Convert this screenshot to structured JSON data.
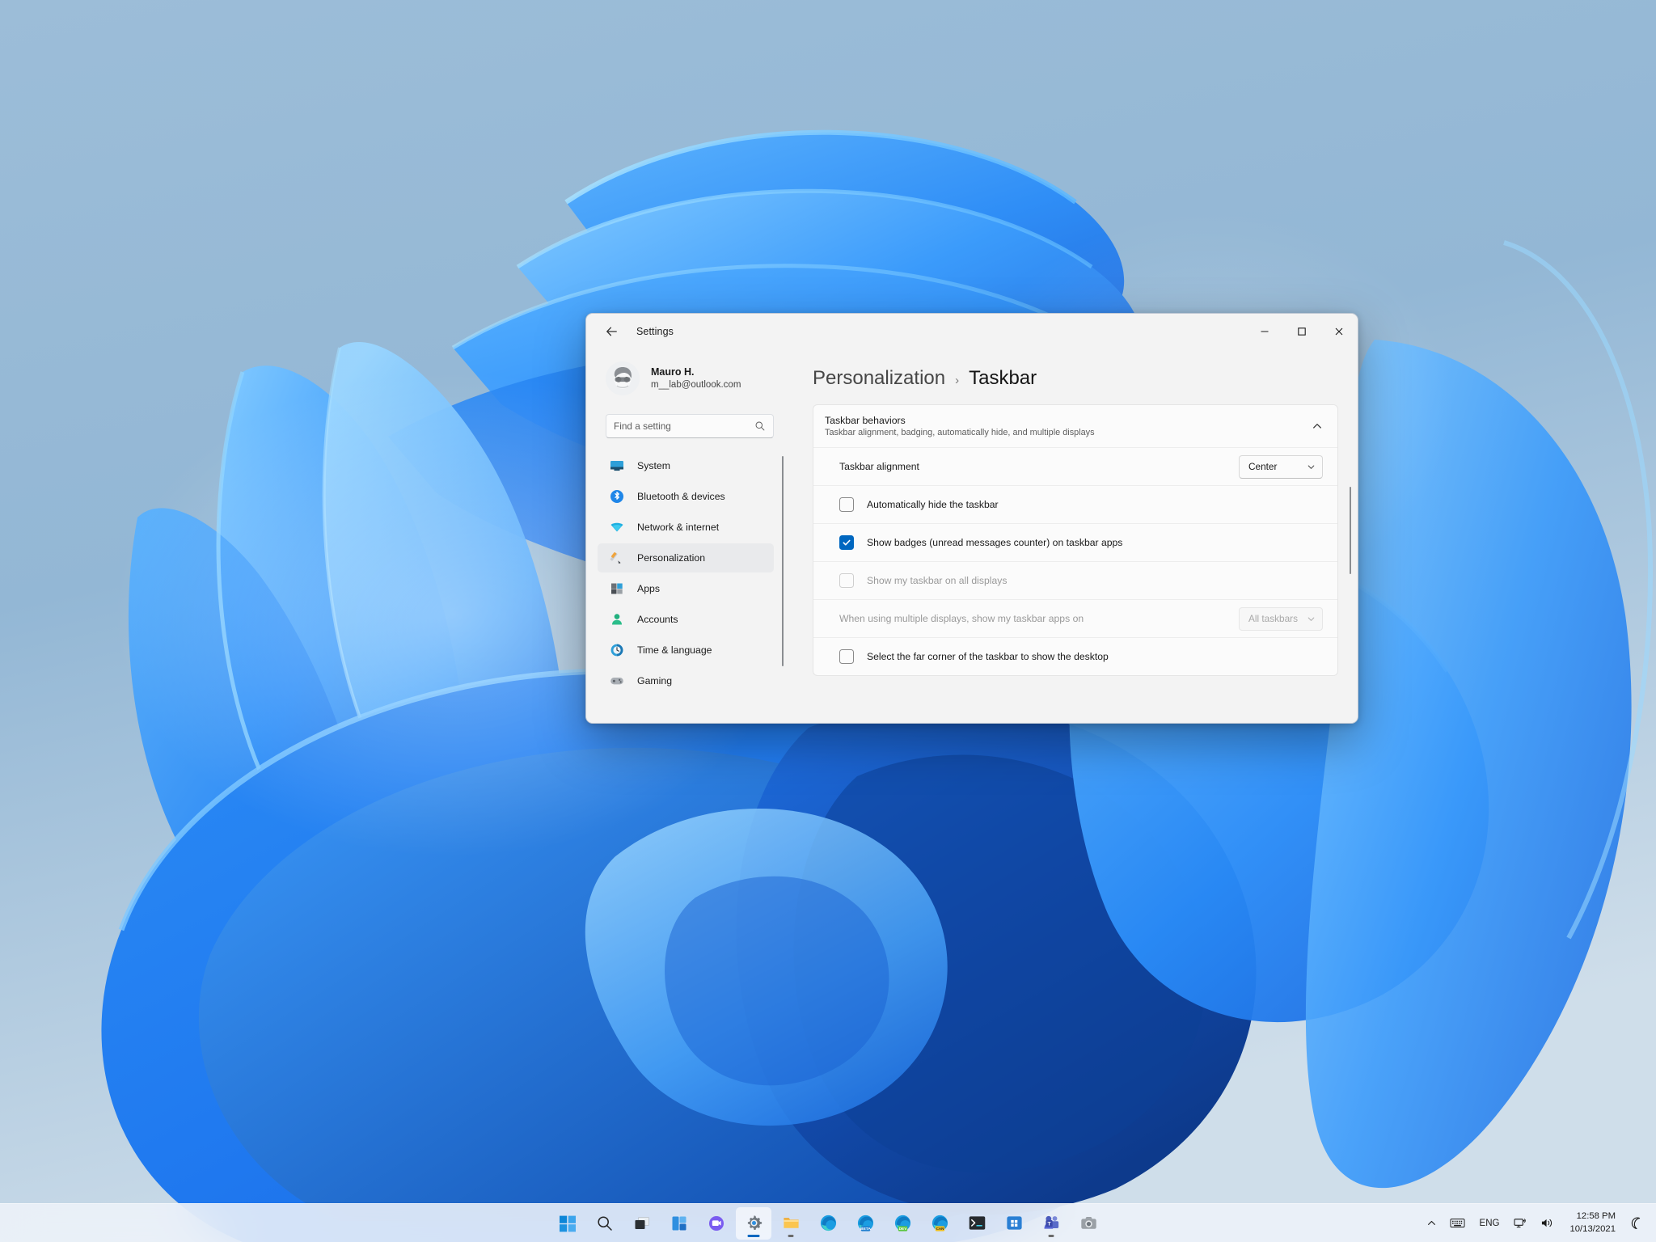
{
  "window": {
    "title": "Settings",
    "back_label": "Back",
    "minimize_label": "Minimize",
    "maximize_label": "Maximize",
    "close_label": "Close"
  },
  "account": {
    "name": "Mauro H.",
    "email": "m__lab@outlook.com"
  },
  "search": {
    "placeholder": "Find a setting"
  },
  "sidebar": {
    "items": [
      {
        "label": "System",
        "icon": "system-icon",
        "active": false
      },
      {
        "label": "Bluetooth & devices",
        "icon": "bluetooth-icon",
        "active": false
      },
      {
        "label": "Network & internet",
        "icon": "network-icon",
        "active": false
      },
      {
        "label": "Personalization",
        "icon": "personalization-icon",
        "active": true
      },
      {
        "label": "Apps",
        "icon": "apps-icon",
        "active": false
      },
      {
        "label": "Accounts",
        "icon": "accounts-icon",
        "active": false
      },
      {
        "label": "Time & language",
        "icon": "time-language-icon",
        "active": false
      },
      {
        "label": "Gaming",
        "icon": "gaming-icon",
        "active": false
      }
    ]
  },
  "breadcrumb": {
    "parent": "Personalization",
    "separator": "›",
    "current": "Taskbar"
  },
  "card": {
    "title": "Taskbar behaviors",
    "subtitle": "Taskbar alignment, badging, automatically hide, and multiple displays",
    "expanded": true,
    "collapse_icon": "chevron-up-icon"
  },
  "rows": [
    {
      "type": "dropdown",
      "label": "Taskbar alignment",
      "value": "Center",
      "disabled": false
    },
    {
      "type": "checkbox",
      "label": "Automatically hide the taskbar",
      "checked": false,
      "disabled": false
    },
    {
      "type": "checkbox",
      "label": "Show badges (unread messages counter) on taskbar apps",
      "checked": true,
      "disabled": false
    },
    {
      "type": "checkbox",
      "label": "Show my taskbar on all displays",
      "checked": false,
      "disabled": true
    },
    {
      "type": "dropdown",
      "label": "When using multiple displays, show my taskbar apps on",
      "value": "All taskbars",
      "disabled": true
    },
    {
      "type": "checkbox",
      "label": "Select the far corner of the taskbar to show the desktop",
      "checked": false,
      "disabled": false
    }
  ],
  "taskbar": {
    "items": [
      {
        "name": "start-button",
        "icon": "windows-logo-icon",
        "running": false,
        "active": false
      },
      {
        "name": "search-button",
        "icon": "search-icon",
        "running": false,
        "active": false
      },
      {
        "name": "task-view-button",
        "icon": "task-view-icon",
        "running": false,
        "active": false
      },
      {
        "name": "widgets-button",
        "icon": "widgets-icon",
        "running": false,
        "active": false
      },
      {
        "name": "chat-button",
        "icon": "chat-icon",
        "running": false,
        "active": false
      },
      {
        "name": "settings-app",
        "icon": "settings-gear-icon",
        "running": true,
        "active": true
      },
      {
        "name": "file-explorer-app",
        "icon": "folder-icon",
        "running": true,
        "active": false
      },
      {
        "name": "edge-app",
        "icon": "edge-icon",
        "running": false,
        "active": false
      },
      {
        "name": "edge-beta-app",
        "icon": "edge-beta-icon",
        "running": false,
        "active": false
      },
      {
        "name": "edge-dev-app",
        "icon": "edge-dev-icon",
        "running": false,
        "active": false
      },
      {
        "name": "edge-canary-app",
        "icon": "edge-canary-icon",
        "running": false,
        "active": false
      },
      {
        "name": "terminal-app",
        "icon": "terminal-icon",
        "running": false,
        "active": false
      },
      {
        "name": "microsoft-store-app",
        "icon": "store-icon",
        "running": false,
        "active": false
      },
      {
        "name": "teams-app",
        "icon": "teams-icon",
        "running": true,
        "active": false
      },
      {
        "name": "camera-app",
        "icon": "camera-icon",
        "running": false,
        "active": false
      }
    ],
    "tray": {
      "show_hidden_icons": "chevron-up-icon",
      "keyboard_icon": "keyboard-icon",
      "language": "ENG",
      "network_icon": "network-tray-icon",
      "volume_icon": "speaker-icon",
      "time": "12:58 PM",
      "date": "10/13/2021",
      "notifications_icon": "moon-icon"
    }
  },
  "colors": {
    "accent": "#0067c0",
    "desktop": "#8fb5d3",
    "window_bg": "#f3f3f3",
    "card_bg": "#fbfbfb"
  }
}
